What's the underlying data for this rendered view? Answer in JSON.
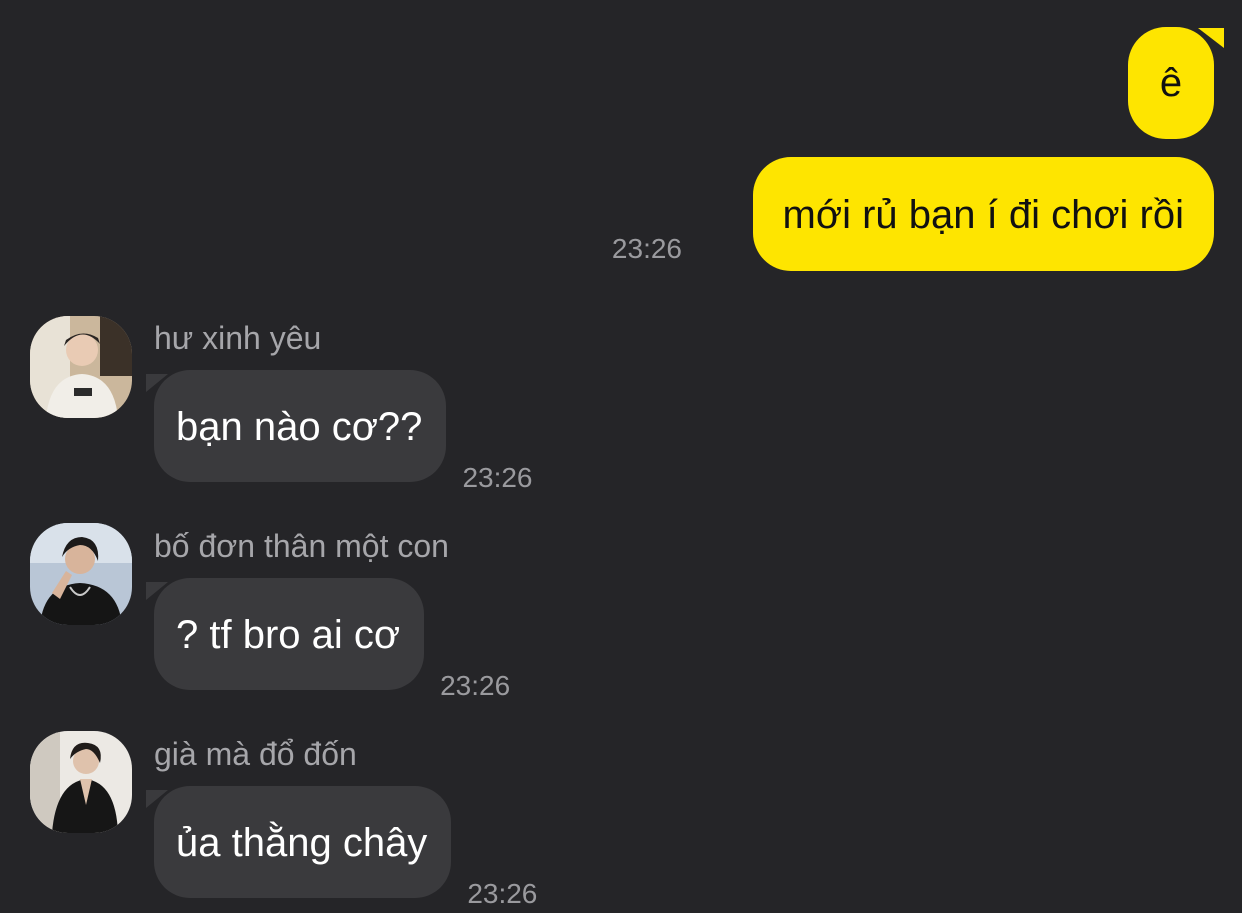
{
  "outgoing": {
    "messages": [
      "ê",
      "mới rủ bạn í đi chơi rồi"
    ],
    "time": "23:26"
  },
  "incoming": [
    {
      "sender": "hư xinh yêu",
      "text": "bạn nào cơ??",
      "time": "23:26"
    },
    {
      "sender": "bố đơn thân một con",
      "text": "? tf bro ai cơ",
      "time": "23:26"
    },
    {
      "sender": "già mà đổ đốn",
      "text": "ủa thằng chây",
      "time": "23:26"
    }
  ],
  "colors": {
    "background": "#252528",
    "outgoing_bubble": "#fee500",
    "incoming_bubble": "#3a3a3d",
    "timestamp": "#9a9a9e",
    "sender_name": "#a6a6aa"
  },
  "icons": {
    "avatars": [
      "avatar-photo",
      "avatar-photo",
      "avatar-photo"
    ]
  }
}
